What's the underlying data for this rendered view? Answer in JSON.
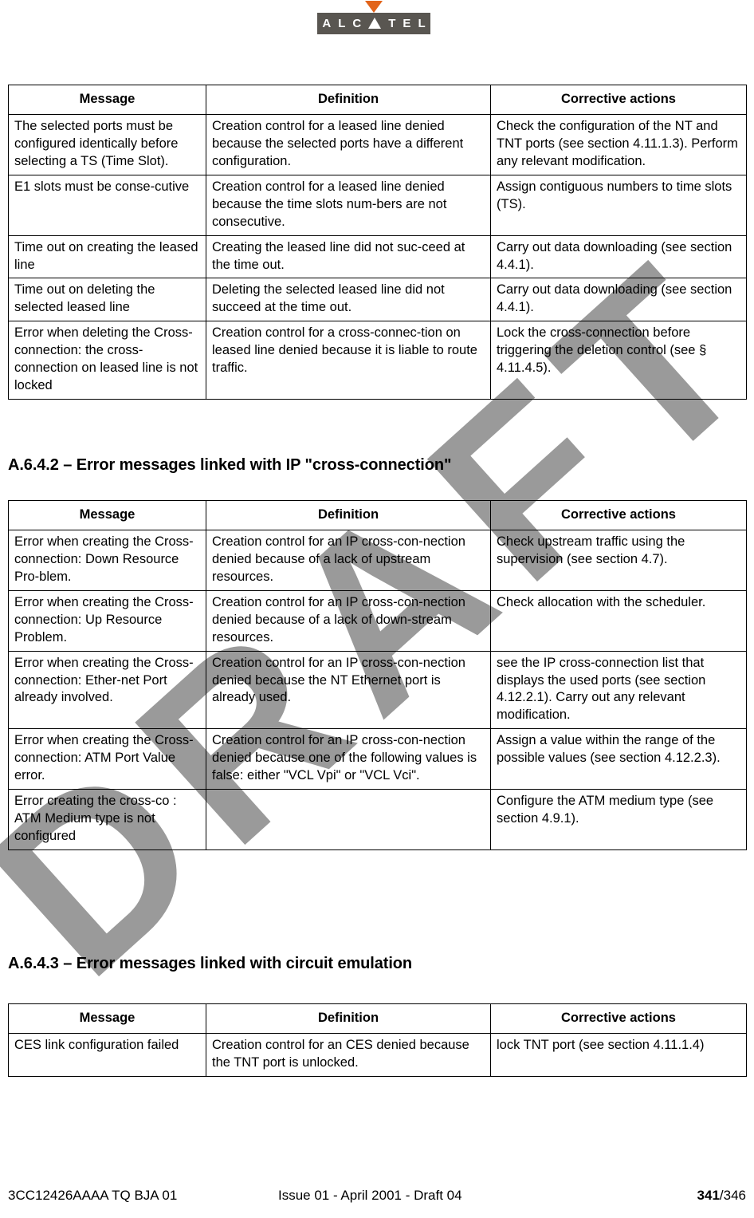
{
  "logo": {
    "name": "ALCATEL",
    "letters": [
      "A",
      "L",
      "C",
      "A-triangle",
      "T",
      "E",
      "L"
    ],
    "box_color": "#595651",
    "triangle_color": "#e2641a"
  },
  "watermark": {
    "text": "DRAFT",
    "color": "#9a9a9a"
  },
  "columns": {
    "message": "Message",
    "definition": "Definition",
    "corrective": "Corrective actions"
  },
  "table_1": {
    "headers": [
      "Message",
      "Definition",
      "Corrective actions"
    ],
    "rows": [
      {
        "message": "The selected ports must be configured identically before selecting a TS (Time Slot).",
        "definition": "Creation control for a leased line denied because the selected ports have a different configuration.",
        "corrective": "Check the configuration of the NT and TNT ports (see section 4.11.1.3). Perform any relevant modification."
      },
      {
        "message": "E1 slots must be conse-cutive",
        "definition": "Creation control for a leased line denied because the time slots num-bers are not consecutive.",
        "corrective": "Assign contiguous numbers to time slots (TS)."
      },
      {
        "message": "Time out on creating the leased line",
        "definition": "Creating the leased line did not suc-ceed at the time out.",
        "corrective": "Carry out data downloading (see section 4.4.1)."
      },
      {
        "message": "Time out on deleting the selected leased line",
        "definition": "Deleting the selected leased line did not succeed at the time out.",
        "corrective": "Carry out data downloading (see section 4.4.1)."
      },
      {
        "message": "Error when deleting the Cross-connection: the cross-connection on leased line is not locked",
        "definition": "Creation control for a cross-connec-tion on leased line denied because it is liable to route traffic.",
        "corrective": "Lock the cross-connection before triggering the deletion control (see § 4.11.4.5)."
      }
    ]
  },
  "heading_a642": "A.6.4.2 – Error messages linked with IP \"cross-connection\"",
  "table_2": {
    "headers": [
      "Message",
      "Definition",
      "Corrective actions"
    ],
    "rows": [
      {
        "message": "Error when creating the Cross-connection: Down Resource Pro-blem.",
        "definition": "Creation control for an IP cross-con-nection denied because of a lack of upstream resources.",
        "corrective": "Check upstream traffic using the supervision (see section 4.7)."
      },
      {
        "message": "Error when creating the Cross-connection: Up Resource Problem.",
        "definition": "Creation control for an IP cross-con-nection denied because of a lack of down-stream resources.",
        "corrective": "Check allocation with the scheduler."
      },
      {
        "message": "Error when creating the Cross-connection: Ether-net Port already involved.",
        "definition": "Creation control for an IP cross-con-nection denied because the NT Ethernet port is already used.",
        "corrective": "see the IP cross-connection list that displays the used ports (see section 4.12.2.1). Carry out any relevant modification."
      },
      {
        "message": "Error when creating the Cross-connection: ATM Port Value error.",
        "definition": "Creation control for an IP cross-con-nection denied because one of the following values is false: either \"VCL Vpi\" or \"VCL Vci\".",
        "corrective": "Assign a value within the range of the possible values (see section 4.12.2.3)."
      },
      {
        "message": "Error creating the cross-co : ATM Medium type is not configured",
        "definition": "",
        "corrective": "Configure the ATM medium type (see section 4.9.1)."
      }
    ]
  },
  "heading_a643": "A.6.4.3 – Error messages linked with circuit emulation",
  "table_3": {
    "headers": [
      "Message",
      "Definition",
      "Corrective actions"
    ],
    "rows": [
      {
        "message": "CES link configuration failed",
        "definition": "Creation control for an CES denied because the TNT port is unlocked.",
        "corrective": "lock TNT port (see section 4.11.1.4)"
      }
    ]
  },
  "footer": {
    "left": "3CC12426AAAA TQ BJA 01",
    "center": "Issue 01 - April 2001 - Draft 04",
    "page": "341",
    "page_total": "/346"
  }
}
